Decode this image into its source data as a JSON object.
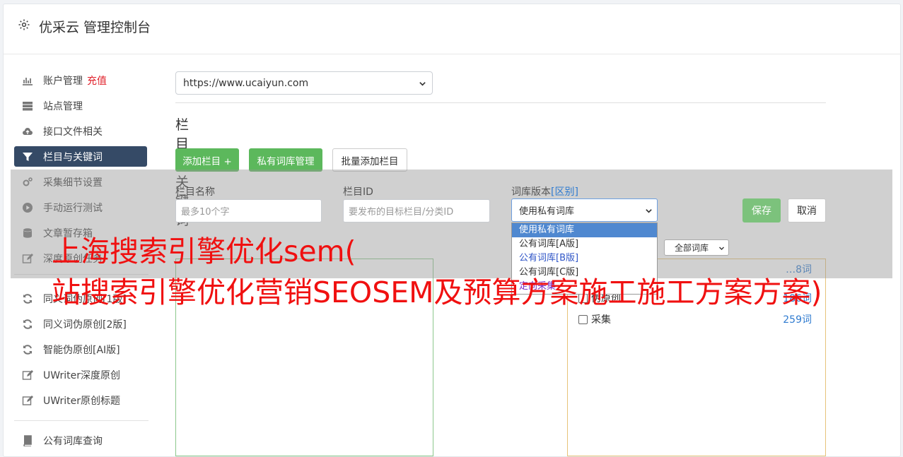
{
  "header": {
    "title": "优采云 管理控制台"
  },
  "sidebar": {
    "items": [
      {
        "label": "账户管理",
        "badge": "充值",
        "icon": "bar-chart-icon"
      },
      {
        "label": "站点管理",
        "icon": "server-icon"
      },
      {
        "label": "接口文件相关",
        "icon": "cloud-upload-icon"
      },
      {
        "label": "栏目与关键词",
        "icon": "filter-icon",
        "active": true
      },
      {
        "label": "采集细节设置",
        "icon": "cogs-icon"
      },
      {
        "label": "手动运行测试",
        "icon": "play-circle-icon"
      },
      {
        "label": "文章暂存箱",
        "icon": "database-icon"
      },
      {
        "label": "深度原创任务",
        "icon": "edit-icon"
      },
      {
        "label": "同义词伪原创[1版]",
        "icon": "refresh-icon"
      },
      {
        "label": "同义词伪原创[2版]",
        "icon": "refresh-icon"
      },
      {
        "label": "智能伪原创[AI版]",
        "icon": "refresh-icon"
      },
      {
        "label": "UWriter深度原创",
        "icon": "edit-icon"
      },
      {
        "label": "UWriter原创标题",
        "icon": "edit-icon"
      },
      {
        "label": "公有词库查询",
        "icon": "book-icon"
      }
    ]
  },
  "main": {
    "site_select": "https://www.ucaiyun.com",
    "section_title": "栏目与关键词",
    "buttons": {
      "add_column": "添加栏目 +",
      "private_lib": "私有词库管理",
      "batch_add": "批量添加栏目"
    },
    "form": {
      "column_name_label": "栏目名称",
      "column_name_placeholder": "最多10个字",
      "column_id_label": "栏目ID",
      "column_id_placeholder": "要发布的目标栏目/分类ID",
      "version_label": "词库版本",
      "version_label_link": "[区别]",
      "version_selected": "使用私有词库",
      "version_options": [
        "使用私有词库",
        "公有词库[A版]",
        "公有词库[B版]",
        "公有词库[C版]",
        "定向采集"
      ],
      "save": "保存",
      "cancel": "取消"
    },
    "keyword_filter": "全部词库",
    "right_panel": {
      "rows": [
        {
          "label": "伪原创",
          "count": "186词"
        },
        {
          "label": "采集",
          "count": "259词"
        }
      ],
      "top_count": "…8词"
    }
  },
  "watermark": {
    "line1": "上海搜索引擎优化sem(",
    "line2": "站搜索引擎优化营销SEOSEM及预算方案施工施工方案方案)"
  }
}
